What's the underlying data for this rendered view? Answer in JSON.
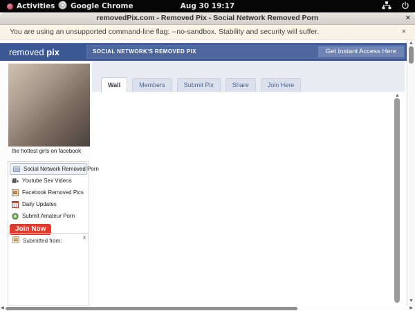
{
  "system_bar": {
    "activities_label": "Activities",
    "app_label": "Google Chrome",
    "clock": "Aug 30 19:17"
  },
  "window": {
    "title": "removedPix.com - Removed Pix - Social Network Removed Porn",
    "close": "×"
  },
  "infobar": {
    "message": "You are using an unsupported command-line flag: --no-sandbox. Stability and security will suffer.",
    "close": "×"
  },
  "header": {
    "logo_first": "removed ",
    "logo_second": "pix",
    "banner_title": "SOCIAL NETWORK'S REMOVED PIX",
    "cta_label": "Get Instant Access Here"
  },
  "tabs": [
    {
      "label": "Wall"
    },
    {
      "label": "Members"
    },
    {
      "label": "Submit Pix"
    },
    {
      "label": "Share"
    },
    {
      "label": "Join Here"
    }
  ],
  "sidebar": {
    "photo_caption": "the hottest girls on facebook",
    "menu": [
      {
        "label": "Social Network Removed Porn",
        "icon": "note-icon"
      },
      {
        "label": "Youtube Sex Videos",
        "icon": "video-camera-icon"
      },
      {
        "label": "Facebook Removed Pics",
        "icon": "photo-icon"
      },
      {
        "label": "Daily Updates",
        "icon": "calendar-icon"
      },
      {
        "label": "Submit Amateur Porn",
        "icon": "camera-icon"
      }
    ],
    "calendar_day": "31",
    "join_button_label": "Join Now",
    "submitted_from_label": "Submitted from:",
    "submitted_from_close": "x"
  },
  "scrollbars": {
    "up": "▲",
    "down": "▼",
    "left": "◀",
    "right": "▶"
  },
  "colors": {
    "header_blue": "#3b5794",
    "band_blue": "#4e689f",
    "cta_blue": "#6e84b5",
    "join_red": "#e23b2e"
  }
}
